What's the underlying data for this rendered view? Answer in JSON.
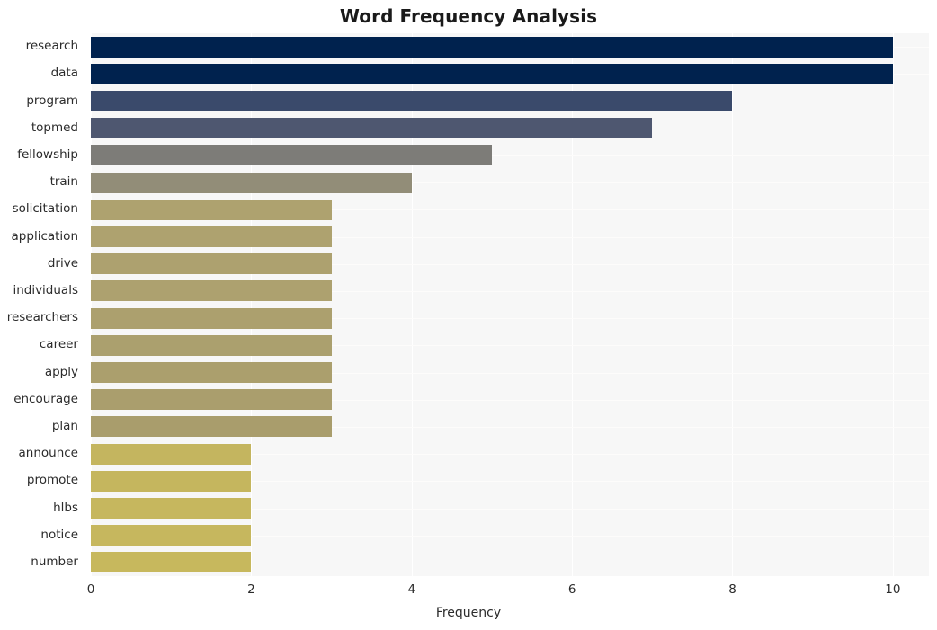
{
  "chart_data": {
    "type": "bar",
    "orientation": "horizontal",
    "title": "Word Frequency Analysis",
    "xlabel": "Frequency",
    "ylabel": "",
    "xlim": [
      0,
      10.45
    ],
    "xticks": [
      "0",
      "2",
      "4",
      "6",
      "8",
      "10"
    ],
    "xtick_values": [
      0,
      2,
      4,
      6,
      8,
      10
    ],
    "grid": true,
    "legend": null,
    "categories": [
      "research",
      "data",
      "program",
      "topmed",
      "fellowship",
      "train",
      "solicitation",
      "application",
      "drive",
      "individuals",
      "researchers",
      "career",
      "apply",
      "encourage",
      "plan",
      "announce",
      "promote",
      "hlbs",
      "notice",
      "number"
    ],
    "values": [
      10,
      10,
      8,
      7,
      5,
      4,
      3,
      3,
      3,
      3,
      3,
      3,
      3,
      3,
      3,
      2,
      2,
      2,
      2,
      2
    ],
    "bar_colors": [
      "#00224e",
      "#00224e",
      "#3a4a6b",
      "#4e5770",
      "#7d7c78",
      "#928d78",
      "#aea26f",
      "#aea26f",
      "#ada16f",
      "#ada16f",
      "#aca06e",
      "#aba06e",
      "#ab9f6d",
      "#aa9e6d",
      "#a99d6c",
      "#c4b55f",
      "#c5b65e",
      "#c6b75e",
      "#c6b75e",
      "#c7b85d"
    ],
    "plot_background": "#f7f7f7",
    "grid_color": "#ffffff",
    "title_color": "#1a1a1a",
    "tick_color": "#2b2b2b"
  }
}
